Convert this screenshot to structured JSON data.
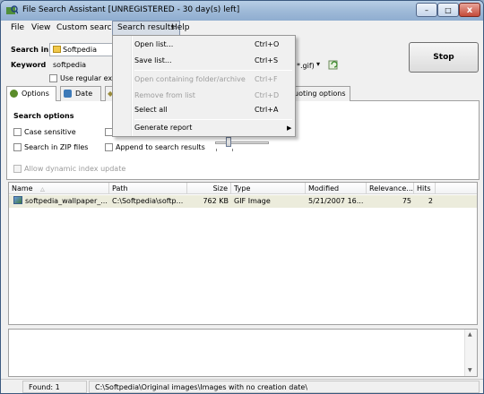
{
  "window": {
    "title": "File Search Assistant [UNREGISTERED - 30 day(s) left]",
    "minimize_glyph": "–",
    "maximize_glyph": "□",
    "close_glyph": "x"
  },
  "menubar": {
    "items": [
      "File",
      "View",
      "Custom search",
      "Search results",
      "Help"
    ]
  },
  "search": {
    "search_in_label": "Search in",
    "search_in_value": "Softpedia",
    "keyword_label": "Keyword",
    "keyword_value": "softpedia",
    "use_regex_label": "Use regular expr",
    "file_mask_value": "*.gif)",
    "stop_label": "Stop"
  },
  "tabs": [
    {
      "label": "Options",
      "icon": "gear-icon"
    },
    {
      "label": "Date",
      "icon": "calendar-icon"
    },
    {
      "label": "uoting options",
      "icon": ""
    }
  ],
  "options": {
    "heading": "Search options",
    "case_sensitive": "Case sensitive",
    "search_zip": "Search in ZIP files",
    "append_results": "Append to search results",
    "allow_dynamic_index": "Allow dynamic index update",
    "slider_level": 0.25
  },
  "results": {
    "columns": [
      "Name",
      "Path",
      "Size",
      "Type",
      "Modified",
      "Relevance...",
      "Hits"
    ],
    "sort_glyph": "△",
    "rows": [
      {
        "name": "softpedia_wallpaper_...",
        "path": "C:\\Softpedia\\softp...",
        "size": "762 KB",
        "type": "GIF Image",
        "modified": "5/21/2007 16...",
        "relevance": "75",
        "hits": "2"
      }
    ]
  },
  "statusbar": {
    "found": "Found: 1",
    "path": "C:\\Softpedia\\Original images\\Images with no creation date\\"
  },
  "dropdown": {
    "items": [
      {
        "label": "Open list...",
        "shortcut": "Ctrl+O",
        "disabled": false
      },
      {
        "label": "Save list...",
        "shortcut": "Ctrl+S",
        "disabled": false
      },
      {
        "label": "Open containing folder/archive",
        "shortcut": "Ctrl+F",
        "disabled": true
      },
      {
        "label": "Remove from list",
        "shortcut": "Ctrl+D",
        "disabled": true
      },
      {
        "label": "Select all",
        "shortcut": "Ctrl+A",
        "disabled": false
      },
      {
        "label": "Generate report",
        "shortcut": "",
        "disabled": false
      }
    ],
    "submenu_glyph": "▶"
  },
  "colors": {
    "titlebar": "#9fbad8",
    "selected_row": "#ececdc",
    "menu_bg": "#f0f0f0",
    "disabled_text": "#9d9d9d"
  }
}
